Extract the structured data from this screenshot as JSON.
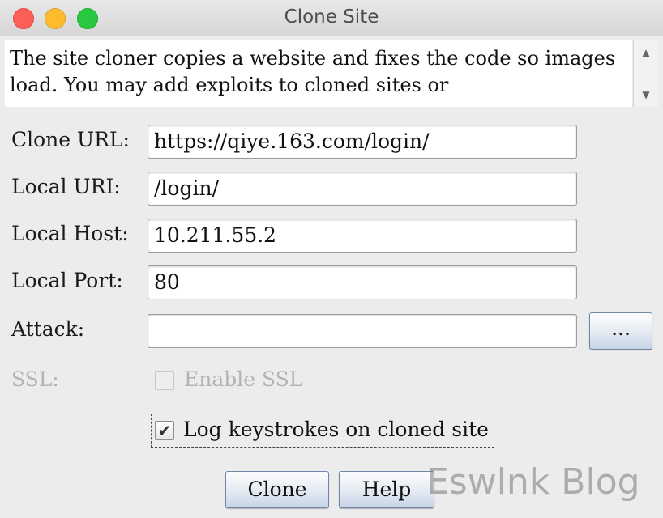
{
  "window": {
    "title": "Clone Site"
  },
  "description": {
    "text": "The site cloner copies a website and fixes the code so images load. You may add exploits to cloned sites or"
  },
  "scrollbar": {
    "up_glyph": "▲",
    "down_glyph": "▼"
  },
  "form": {
    "clone_url": {
      "label": "Clone URL:",
      "value": "https://qiye.163.com/login/"
    },
    "local_uri": {
      "label": "Local URI:",
      "value": "/login/"
    },
    "local_host": {
      "label": "Local Host:",
      "value": "10.211.55.2"
    },
    "local_port": {
      "label": "Local Port:",
      "value": "80"
    },
    "attack": {
      "label": "Attack:",
      "value": "",
      "browse_label": "..."
    },
    "ssl": {
      "label": "SSL:",
      "checkbox_label": "Enable SSL",
      "checked": false,
      "enabled": false
    },
    "log_keystrokes": {
      "label": "Log keystrokes on cloned site",
      "checked": true,
      "check_glyph": "✔"
    }
  },
  "buttons": {
    "clone": "Clone",
    "help": "Help"
  },
  "watermark": "Eswlnk Blog"
}
